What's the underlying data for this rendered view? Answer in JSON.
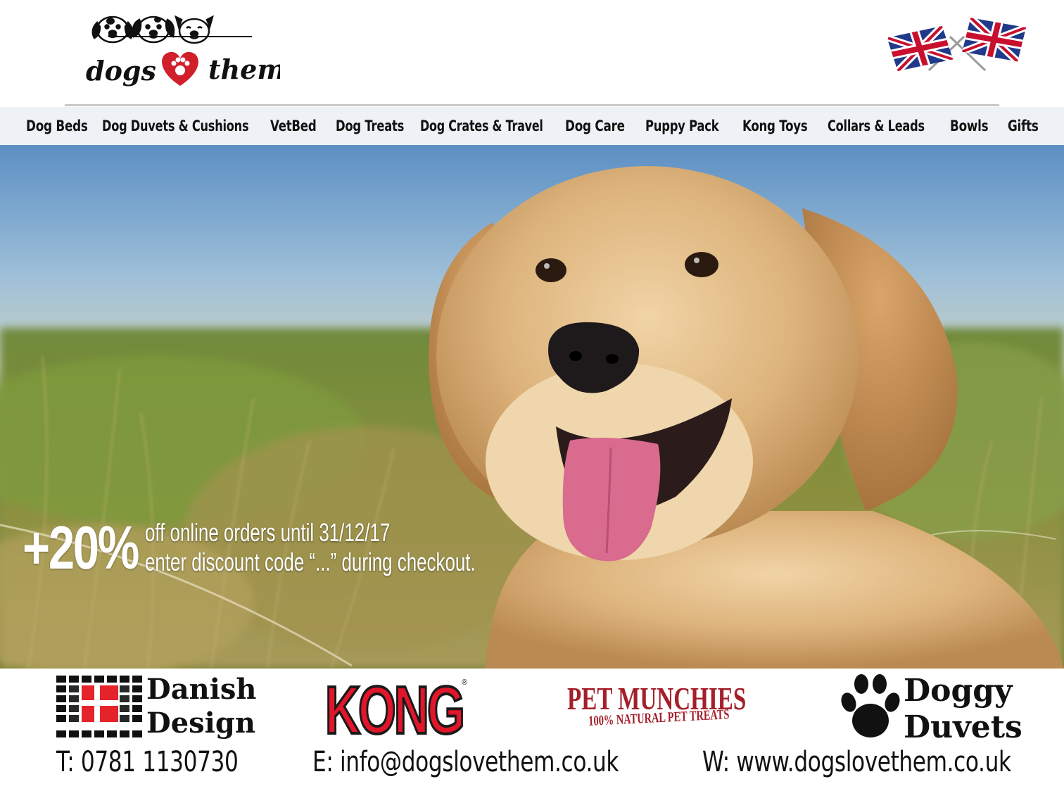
{
  "brand": {
    "logo_word_left": "dogs",
    "logo_word_right": "them"
  },
  "nav": {
    "items": [
      {
        "label": "Dog Beds"
      },
      {
        "label": "Dog Duvets & Cushions"
      },
      {
        "label": "VetBed"
      },
      {
        "label": "Dog Treats"
      },
      {
        "label": "Dog Crates & Travel"
      },
      {
        "label": "Dog Care"
      },
      {
        "label": "Puppy Pack"
      },
      {
        "label": "Kong Toys"
      },
      {
        "label": "Collars & Leads"
      },
      {
        "label": "Bowls"
      },
      {
        "label": "Gifts"
      }
    ]
  },
  "promo": {
    "amount": "+20%",
    "line1": "off online orders until 31/12/17",
    "line2": "enter discount code “...” during checkout."
  },
  "partners": {
    "danish_line1": "Danish",
    "danish_line2": "Design",
    "kong": "KONG",
    "kong_reg": "®",
    "pet_munchies_title": "PET MUNCHIES",
    "pet_munchies_sub": "100% NATURAL PET TREATS",
    "doggy_line1": "Doggy",
    "doggy_line2": "Duvets"
  },
  "contact": {
    "phone": "T: 0781 1130730",
    "email": "E: info@dogslovethem.co.uk",
    "web": "W: www.dogslovethem.co.uk"
  },
  "colors": {
    "nav_bg": "#eef2f7",
    "heart_red": "#d11f2c",
    "kong_red": "#e2162b",
    "pet_munchies_red": "#a3202a",
    "danish_red": "#e4232b"
  },
  "icons": [
    "dog-faces-logo-icon",
    "heart-paw-icon",
    "union-jack-flags-icon",
    "paw-print-icon",
    "danish-flag-grid-icon"
  ]
}
